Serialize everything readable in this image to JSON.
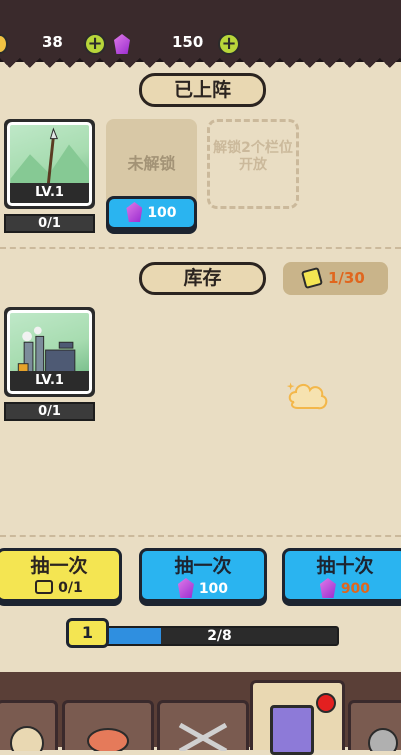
{
  "currency": {
    "coins": "38",
    "gems": "150"
  },
  "deployed": {
    "title": "已上阵",
    "slot1": {
      "level": "LV.1",
      "count": "0/1"
    },
    "slot2": {
      "locked_label": "未解锁",
      "unlock_cost": "100"
    },
    "slot3": {
      "hint": "解锁2个栏位开放"
    }
  },
  "inventory": {
    "title": "库存",
    "capacity": "1/30",
    "items": [
      {
        "level": "LV.1",
        "count": "0/1"
      }
    ]
  },
  "draw": {
    "free": {
      "label": "抽一次",
      "sub": "0/1"
    },
    "single": {
      "label": "抽一次",
      "cost": "100"
    },
    "ten": {
      "label": "抽十次",
      "cost": "900"
    }
  },
  "progress": {
    "level": "1",
    "text": "2/8",
    "fraction": 0.25
  }
}
